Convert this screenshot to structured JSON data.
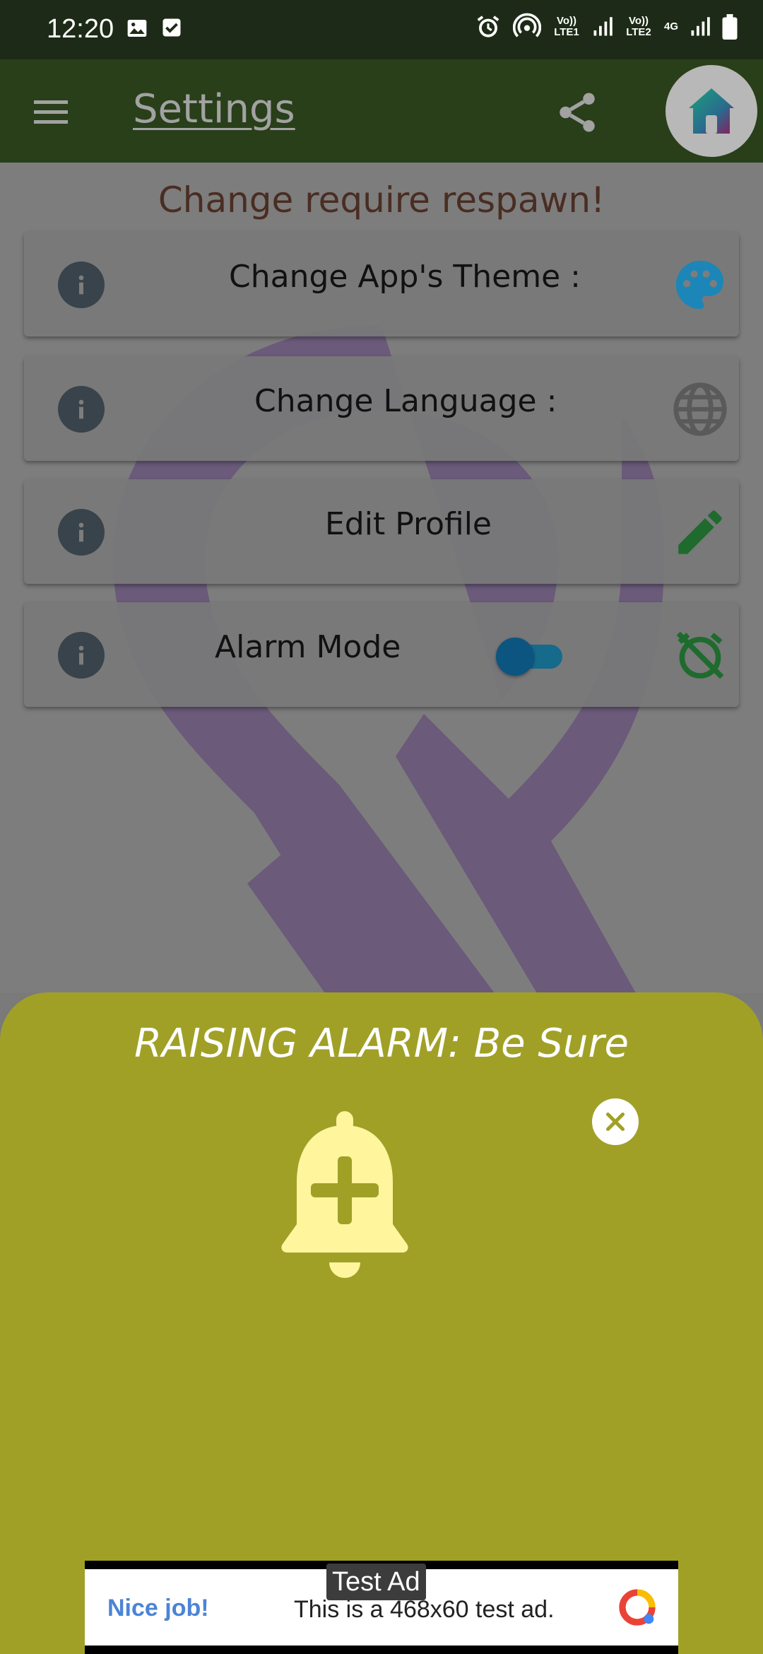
{
  "status_bar": {
    "time": "12:20",
    "sim1_label": "Vo)) LTE1",
    "sim2_label": "Vo)) LTE2",
    "network": "4G"
  },
  "app_bar": {
    "title": "Settings"
  },
  "notice": "Change require respawn!",
  "settings": [
    {
      "label": "Change App's Theme :",
      "icon": "palette-icon"
    },
    {
      "label": "Change Language :",
      "icon": "globe-icon"
    },
    {
      "label": "Edit Profile",
      "icon": "pencil-icon"
    },
    {
      "label": "Alarm Mode",
      "icon": "alarm-off-icon",
      "toggle_on": true
    }
  ],
  "sheet": {
    "title": "RAISING ALARM: Be Sure"
  },
  "ad": {
    "badge": "Test Ad",
    "headline": "Nice job!",
    "text": "This is a 468x60 test ad."
  },
  "colors": {
    "status_bar": "#1d2a17",
    "app_bar": "#283f1a",
    "sheet": "#a0a027",
    "bell": "#fff59d",
    "ribbon": "#6b5a7a"
  }
}
